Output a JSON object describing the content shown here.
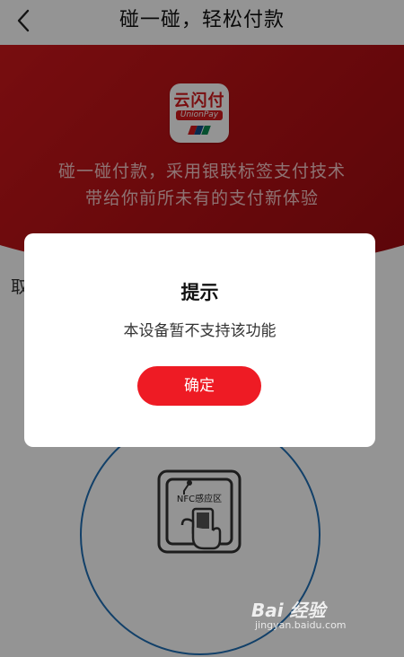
{
  "navbar": {
    "title": "碰一碰，轻松付款"
  },
  "hero": {
    "logo_text": "云闪付",
    "logo_sub": "UnionPay",
    "line1": "碰一碰付款，采用银联标签支付技术",
    "line2": "带给你前所未有的支付新体验"
  },
  "side_label": "取",
  "nfc": {
    "label": "NFC感应区"
  },
  "dialog": {
    "title": "提示",
    "message": "本设备暂不支持该功能",
    "confirm_label": "确定"
  },
  "watermark": {
    "text": "Bai 经验",
    "sub": "jingyan.baidu.com"
  },
  "colors": {
    "accent": "#ee1b24",
    "hero_red": "#b41015",
    "nfc_ring": "#1f6fb5"
  }
}
